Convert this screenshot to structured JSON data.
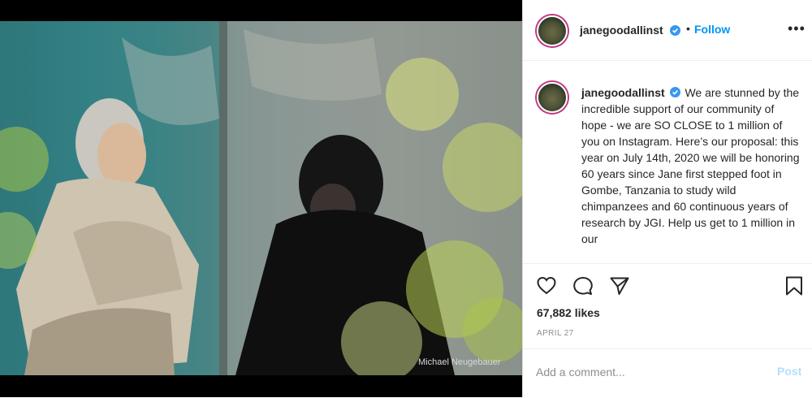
{
  "post": {
    "photo_credit": "Michael Neugebauer",
    "username": "janegoodallinst",
    "follow_label": "Follow",
    "dot": "•",
    "more_label": "•••",
    "caption": "We are stunned by the incredible support of our community of hope - we are SO CLOSE to 1 million of you on Instagram. Here’s our proposal: this year on July 14th, 2020 we will be honoring 60 years since Jane first stepped foot in Gombe, Tanzania to study wild chimpanzees and 60 continuous years of research by JGI. Help us get to 1 million in our",
    "likes": "67,882 likes",
    "date": "APRIL 27",
    "comment_placeholder": "Add a comment...",
    "post_label": "Post"
  },
  "icons": {
    "verified": "verified-badge-icon",
    "like": "heart-icon",
    "comment": "comment-bubble-icon",
    "share": "paper-plane-icon",
    "save": "bookmark-icon"
  },
  "colors": {
    "link": "#0095f6",
    "post_disabled": "#b2dffc",
    "text": "#262626",
    "muted": "#8e8e8e",
    "verified": "#3897f0",
    "story_ring": "#c13584"
  }
}
